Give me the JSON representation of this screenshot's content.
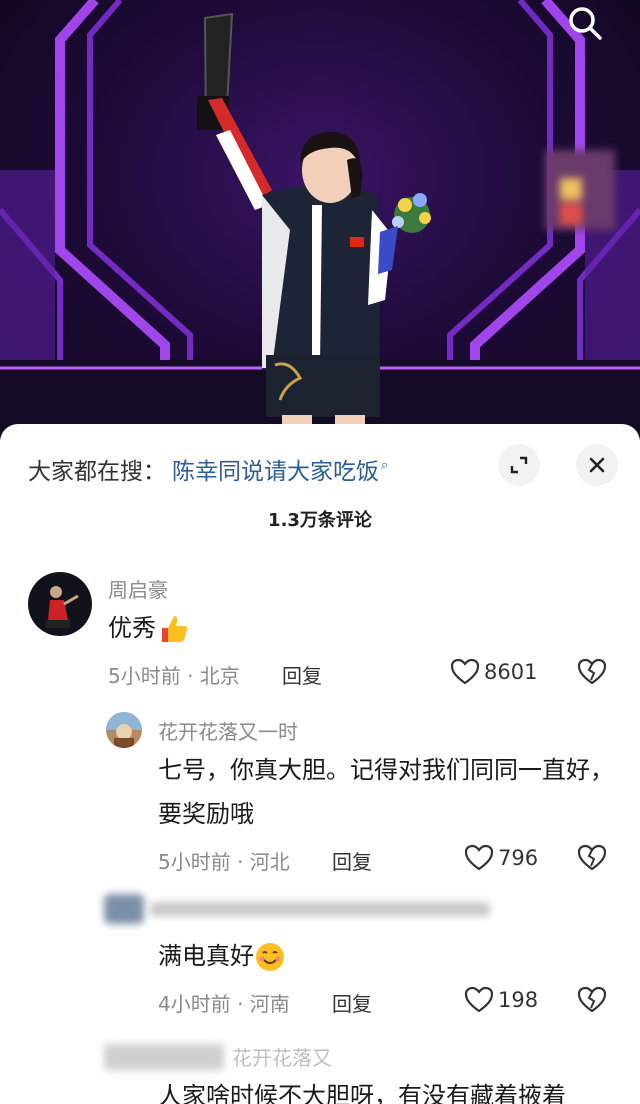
{
  "hero": {
    "search_icon": "search-icon"
  },
  "sheet": {
    "trending_label": "大家都在搜：",
    "trending_keyword": "陈幸同说请大家吃饭",
    "comment_count": "1.3万条评论"
  },
  "comments": [
    {
      "user": "周启豪",
      "text": "优秀",
      "emoji": "thumbs-up",
      "meta": "5小时前 · 北京",
      "reply": "回复",
      "likes": "8601"
    },
    {
      "user": "花开花落又一时",
      "text": "七号，你真大胆。记得对我们同同一直好，要奖励哦",
      "meta": "5小时前 · 河北",
      "reply": "回复",
      "likes": "796"
    },
    {
      "text": "满电真好",
      "emoji": "smiling-face",
      "meta": "4小时前 · 河南",
      "reply": "回复",
      "likes": "198"
    },
    {
      "user": "花开花落又",
      "text": "人家啥时候不大胆呀，有没有藏着掖着"
    }
  ],
  "colors": {
    "link": "#2d5d96",
    "muted": "#8a8a8a",
    "stage_purple": "#9b3cff"
  }
}
